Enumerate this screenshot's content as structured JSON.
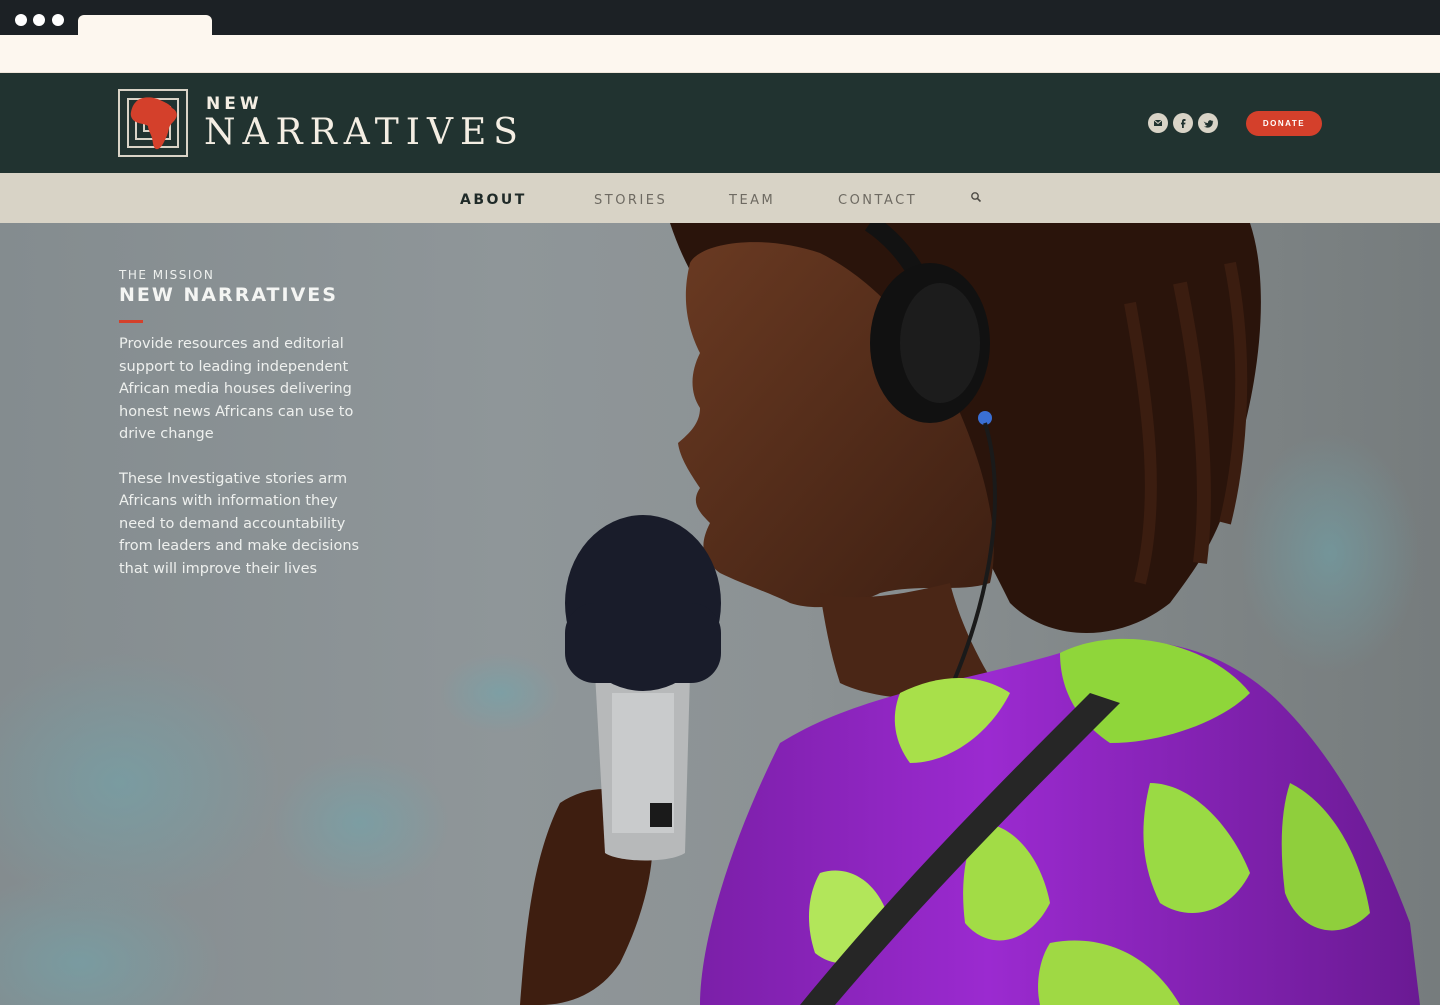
{
  "brand": {
    "line1": "NEW",
    "line2": "NARRATIVES",
    "accent_color": "#d4402b",
    "header_color": "#213330"
  },
  "header": {
    "social_icons": [
      "email-icon",
      "facebook-icon",
      "twitter-icon"
    ],
    "donate_label": "DONATE"
  },
  "nav": {
    "items": [
      {
        "label": "ABOUT",
        "active": true
      },
      {
        "label": "STORIES",
        "active": false
      },
      {
        "label": "TEAM",
        "active": false
      },
      {
        "label": "CONTACT",
        "active": false
      }
    ],
    "search_icon": "search-icon"
  },
  "hero": {
    "eyebrow": "THE MISSION",
    "title": "NEW NARRATIVES",
    "paragraphs": [
      "Provide resources and editorial support to leading independent African media houses delivering honest news Africans can use to drive change",
      "These Investigative stories arm Africans with information they need to demand accountability from leaders and make decisions that will improve their lives"
    ]
  }
}
